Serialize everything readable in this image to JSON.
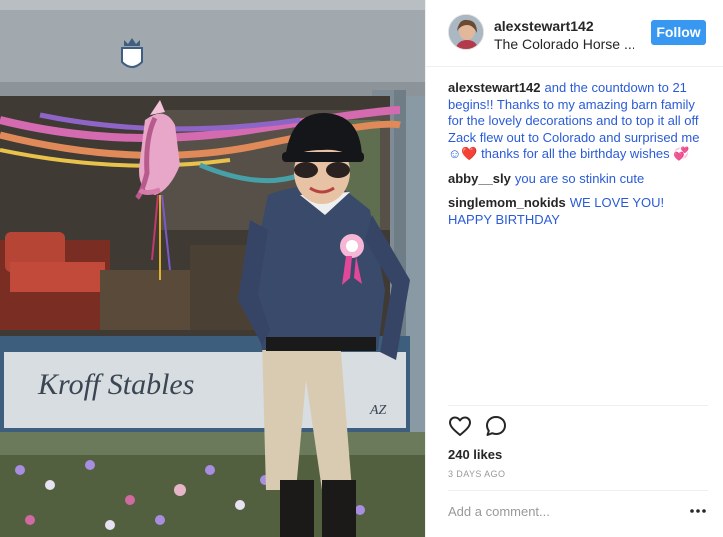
{
  "post": {
    "photo_sign_text": "Kroff Stables",
    "photo_sign_suffix": "AZ"
  },
  "header": {
    "username": "alexstewart142",
    "location": "The Colorado Horse ...",
    "follow_label": "Follow"
  },
  "comments": [
    {
      "user": "alexstewart142",
      "text": "and the countdown to 21 begins!! Thanks to my amazing barn family for the lovely decorations and to top it all off Zack flew out to Colorado and surprised me ☺❤️ thanks for all the birthday wishes 💞"
    },
    {
      "user": "abby__sly",
      "text": "you are so stinkin cute"
    },
    {
      "user": "singlemom_nokids",
      "text": "WE LOVE YOU! HAPPY BIRTHDAY"
    }
  ],
  "actions": {
    "like_icon": "heart-icon",
    "comment_icon": "speech-bubble-icon"
  },
  "likes_text": "240 likes",
  "time_ago": "3 DAYS AGO",
  "add_comment": {
    "placeholder": "Add a comment...",
    "more_icon": "ellipsis-icon"
  },
  "colors": {
    "accent_blue": "#3897f0",
    "link_blue": "#2a5bd7"
  }
}
